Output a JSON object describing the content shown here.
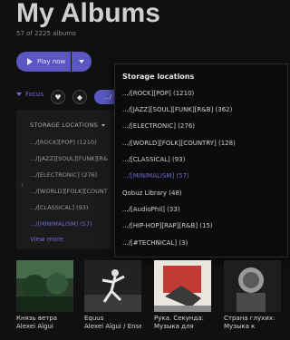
{
  "header": {
    "title": "My Albums",
    "subtitle": "57 of 2225 albums"
  },
  "toolbar": {
    "play_label": "Play now"
  },
  "focus": {
    "label": "Focus",
    "tag_label": ".../"
  },
  "filter_panel": {
    "header": "STORAGE LOCATIONS",
    "items": [
      {
        "label": ".../[ROCK][POP] (1210)"
      },
      {
        "label": ".../[JAZZ][SOUL][FUNK][R&"
      },
      {
        "label": ".../[ELECTRONIC] (276)"
      },
      {
        "label": ".../[WORLD][FOLK][COUNT"
      },
      {
        "label": ".../[CLASSICAL] (93)"
      },
      {
        "label": ".../[MINIMALISM] (57)",
        "active": true
      }
    ],
    "view_more": "View more"
  },
  "dropdown": {
    "title": "Storage locations",
    "items": [
      {
        "label": ".../[ROCK][POP] (1210)"
      },
      {
        "label": ".../[JAZZ][SOUL][FUNK][R&B] (362)"
      },
      {
        "label": ".../[ELECTRONIC] (276)"
      },
      {
        "label": ".../[WORLD][FOLK][COUNTRY] (128)"
      },
      {
        "label": ".../[CLASSICAL] (93)"
      },
      {
        "label": ".../[MINIMALISM] (57)",
        "active": true
      },
      {
        "label": "Qobuz Library (48)"
      },
      {
        "label": ".../[AudioPhil] (33)"
      },
      {
        "label": ".../[HIP-HOP][RAP][R&B] (15)"
      },
      {
        "label": ".../[#TECHNICAL] (3)"
      }
    ]
  },
  "albums": [
    {
      "title": "Князь ветра",
      "artist": "Alexei Aïgui"
    },
    {
      "title": "Equus",
      "artist": "Alexei Aïgui / Ensem"
    },
    {
      "title": "Рука. Секунда:",
      "artist": "Музыка для"
    },
    {
      "title": "Страна глухих:",
      "artist": "Музыка к"
    }
  ],
  "colors": {
    "accent": "#5a57c2",
    "accent_text": "#6c69d6",
    "background": "#101010"
  }
}
